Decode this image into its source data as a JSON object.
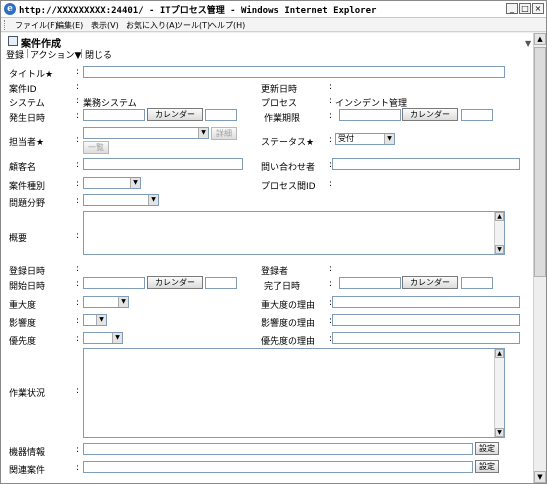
{
  "window": {
    "title": "http://XXXXXXXXX:24401/ - ITプロセス管理 - Windows Internet Explorer",
    "icon_letter": "e"
  },
  "menubar": [
    "ファイル(F)",
    "編集(E)",
    "表示(V)",
    "お気に入り(A)",
    "ツール(T)",
    "ヘルプ(H)"
  ],
  "page": {
    "title": "案件作成",
    "actions": {
      "register": "登録",
      "action": "アクション▼",
      "close": "閉じる"
    }
  },
  "form": {
    "colon": ":",
    "title_label": "タイトル★",
    "case_id_label": "案件ID",
    "updated_label": "更新日時",
    "system_label": "システム",
    "system_value": "業務システム",
    "process_label": "プロセス",
    "process_value": "インシデント管理",
    "occurred_label": "発生日時",
    "deadline_label": "作業期限",
    "calendar_button": "カレンダー",
    "assignee_label": "担当者★",
    "detail_button": "詳細",
    "list_button": "一覧",
    "status_label": "ステータス★",
    "status_value": "受付",
    "customer_label": "顧客名",
    "inquirer_label": "問い合わせ者",
    "case_type_label": "案件種別",
    "process_rel_id_label": "プロセス間ID",
    "problem_area_label": "問題分野",
    "summary_label": "概要",
    "registered_date_label": "登録日時",
    "registrant_label": "登録者",
    "start_label": "開始日時",
    "complete_label": "完了日時",
    "severity_label": "重大度",
    "severity_reason_label": "重大度の理由",
    "impact_label": "影響度",
    "impact_reason_label": "影響度の理由",
    "priority_label": "優先度",
    "priority_reason_label": "優先度の理由",
    "work_status_label": "作業状況",
    "equipment_label": "機器情報",
    "related_case_label": "関連案件",
    "settings_button": "設定"
  }
}
